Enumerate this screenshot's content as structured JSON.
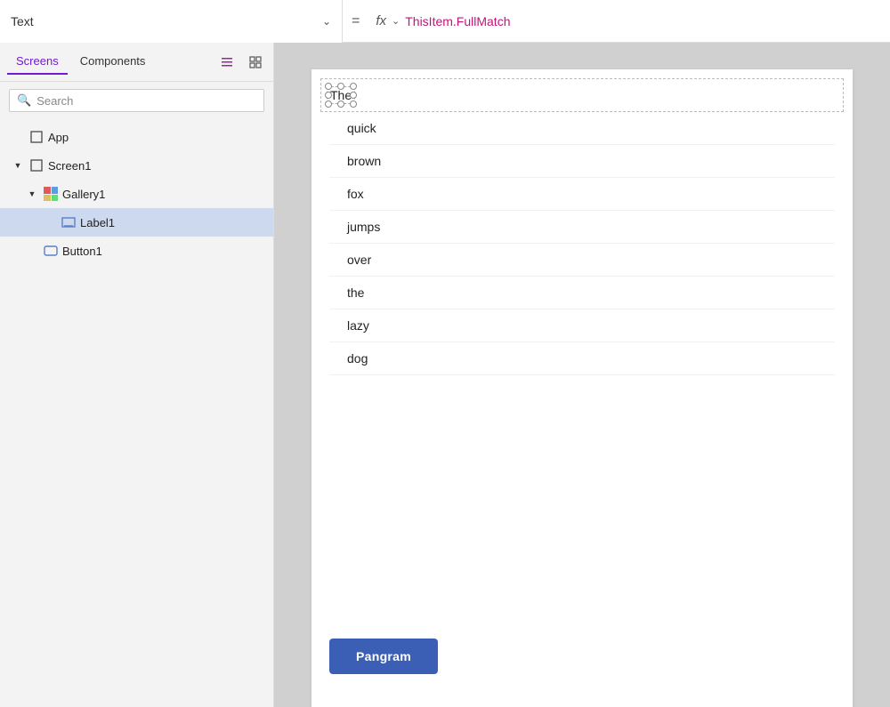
{
  "topbar": {
    "property_label": "Text",
    "equals": "=",
    "fx_label": "fx",
    "formula": "ThisItem.FullMatch"
  },
  "sidebar": {
    "tab_screens": "Screens",
    "tab_components": "Components",
    "search_placeholder": "Search",
    "tree": [
      {
        "id": "app",
        "label": "App",
        "indent": 0,
        "icon": "app",
        "expandable": false
      },
      {
        "id": "screen1",
        "label": "Screen1",
        "indent": 0,
        "icon": "screen",
        "expandable": true,
        "expanded": true
      },
      {
        "id": "gallery1",
        "label": "Gallery1",
        "indent": 1,
        "icon": "gallery",
        "expandable": true,
        "expanded": true
      },
      {
        "id": "label1",
        "label": "Label1",
        "indent": 2,
        "icon": "label",
        "expandable": false,
        "selected": true
      },
      {
        "id": "button1",
        "label": "Button1",
        "indent": 1,
        "icon": "button",
        "expandable": false
      }
    ]
  },
  "canvas": {
    "first_item": "The",
    "items": [
      "quick",
      "brown",
      "fox",
      "jumps",
      "over",
      "the",
      "lazy",
      "dog"
    ],
    "button_label": "Pangram"
  }
}
